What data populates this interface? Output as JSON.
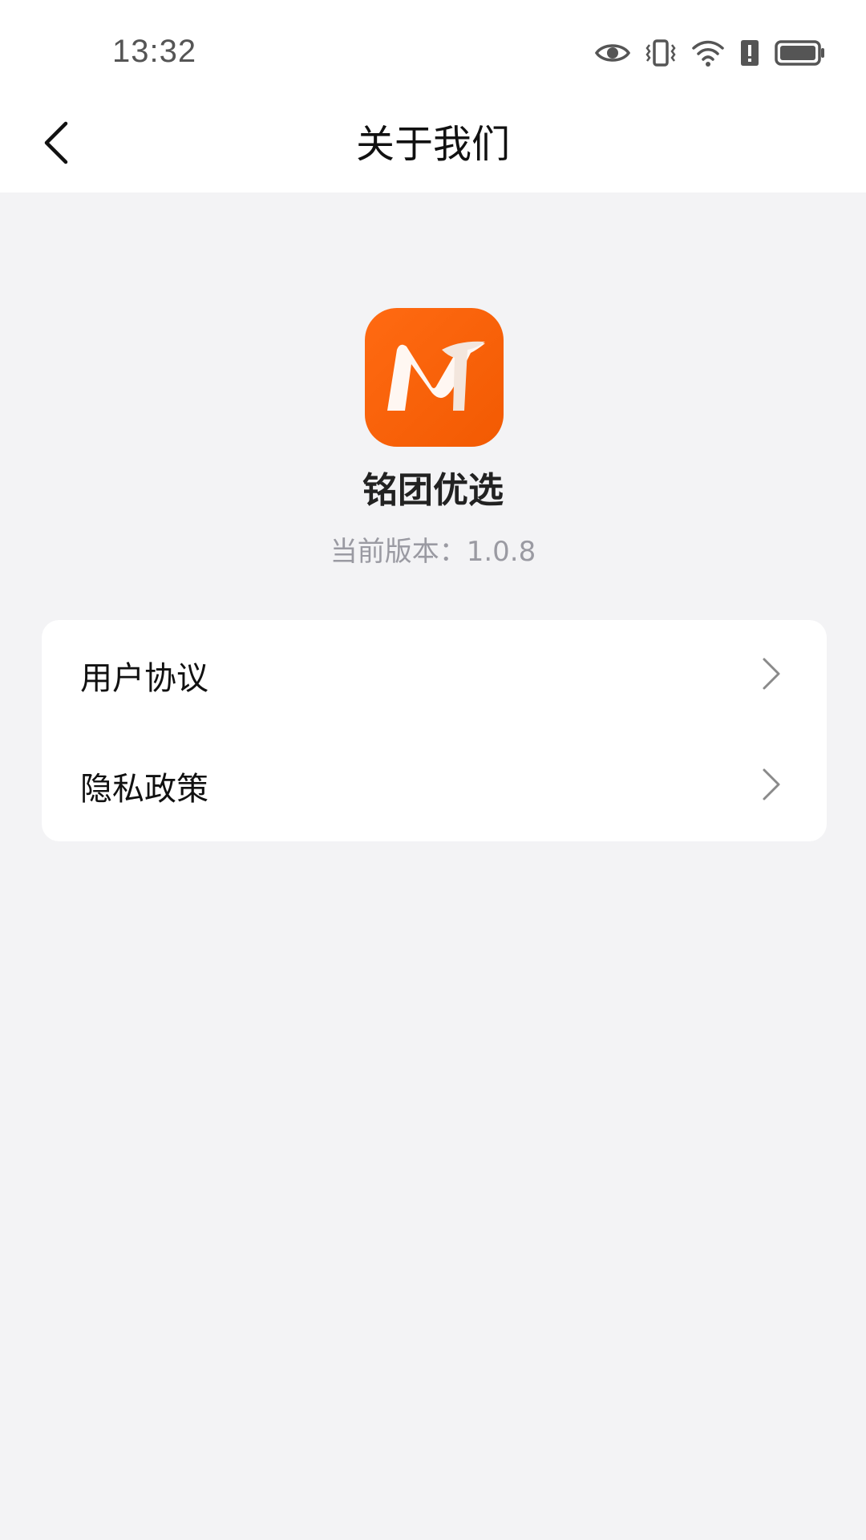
{
  "status_bar": {
    "time": "13:32",
    "icons": [
      "eye-icon",
      "vibrate-icon",
      "wifi-icon",
      "alert-icon",
      "battery-icon"
    ]
  },
  "nav": {
    "title": "关于我们",
    "back_icon": "chevron-left-icon"
  },
  "app": {
    "name": "铭团优选",
    "version_text": "当前版本：1.0.8",
    "logo_letters": "MT",
    "brand_color": "#f7620a"
  },
  "menu": {
    "items": [
      {
        "label": "用户协议",
        "icon": "chevron-right-icon"
      },
      {
        "label": "隐私政策",
        "icon": "chevron-right-icon"
      }
    ]
  }
}
